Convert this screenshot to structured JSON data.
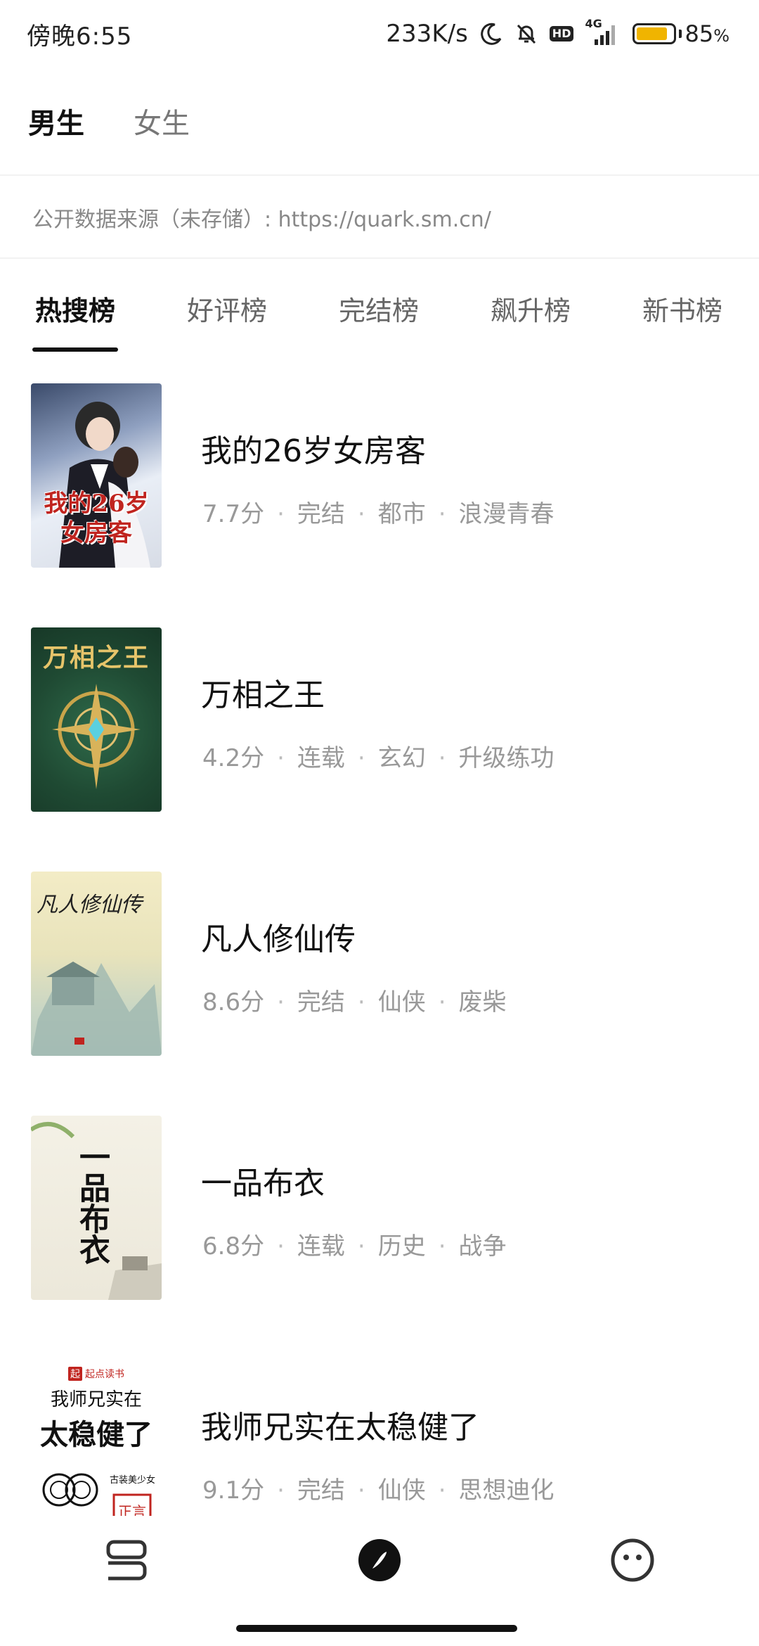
{
  "status_bar": {
    "time": "傍晚6:55",
    "network_speed": "233K/s",
    "network_type": "4G",
    "hd_label": "HD",
    "battery_percent": "85",
    "battery_suffix": "%",
    "battery_level": 0.85,
    "battery_color": "#f0b400"
  },
  "gender_tabs": [
    {
      "label": "男生",
      "active": true
    },
    {
      "label": "女生",
      "active": false
    }
  ],
  "source_notice": "公开数据来源（未存储）: https://quark.sm.cn/",
  "rank_tabs": [
    {
      "label": "热搜榜",
      "active": true
    },
    {
      "label": "好评榜",
      "active": false
    },
    {
      "label": "完结榜",
      "active": false
    },
    {
      "label": "飙升榜",
      "active": false
    },
    {
      "label": "新书榜",
      "active": false
    }
  ],
  "books": [
    {
      "title": "我的26岁女房客",
      "score": "7.7分",
      "status": "完结",
      "category": "都市",
      "tag": "浪漫青春",
      "cover_text": "我的26岁女房客"
    },
    {
      "title": "万相之王",
      "score": "4.2分",
      "status": "连载",
      "category": "玄幻",
      "tag": "升级练功",
      "cover_text": "万相之王"
    },
    {
      "title": "凡人修仙传",
      "score": "8.6分",
      "status": "完结",
      "category": "仙侠",
      "tag": "废柴",
      "cover_text": "凡人修仙传"
    },
    {
      "title": "一品布衣",
      "score": "6.8分",
      "status": "连载",
      "category": "历史",
      "tag": "战争",
      "cover_text": "一品布衣"
    },
    {
      "title": "我师兄实在太稳健了",
      "score": "9.1分",
      "status": "完结",
      "category": "仙侠",
      "tag": "思想迪化",
      "cover_text_top": "我师兄实在",
      "cover_text_bottom": "太稳健了",
      "cover_publisher": "起点读书",
      "cover_badge": "古装美少女",
      "cover_stamp": "正言"
    }
  ],
  "separator": "·",
  "bottom_nav": [
    {
      "icon": "bookshelf-icon"
    },
    {
      "icon": "discover-compass-icon",
      "active": true
    },
    {
      "icon": "profile-face-icon"
    }
  ]
}
